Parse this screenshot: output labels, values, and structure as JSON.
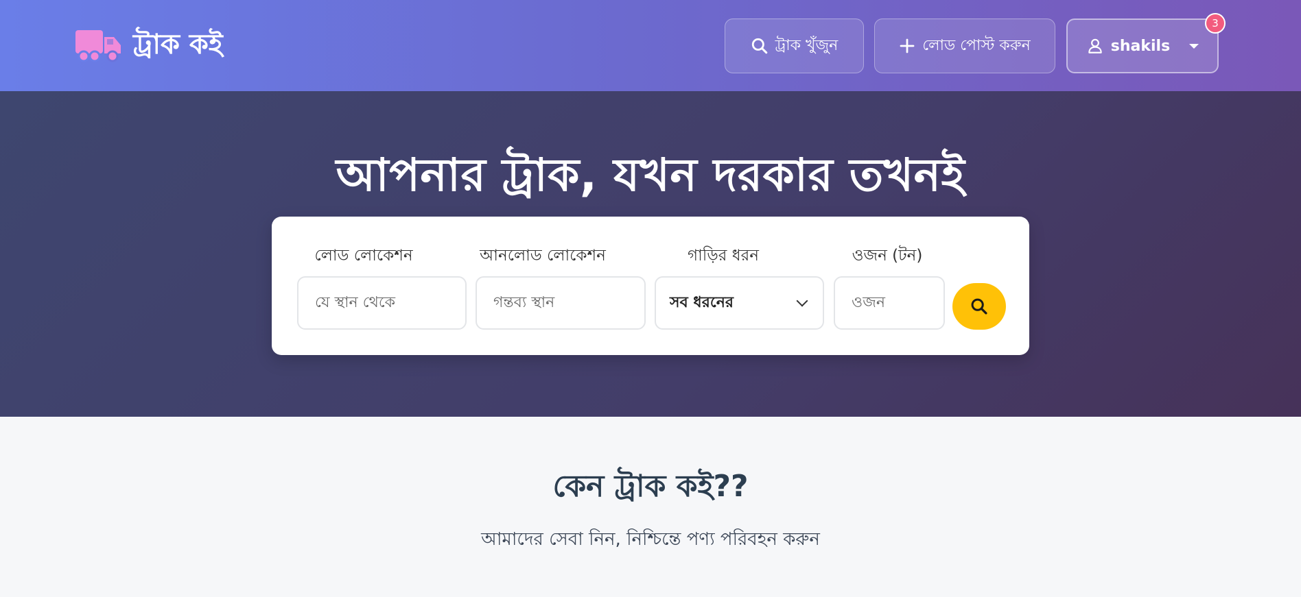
{
  "brand": {
    "name": "ট্রাক কই",
    "icon": "truck-icon",
    "icon_color": "#f08ad9"
  },
  "nav": {
    "find_truck_label": "ট্রাক খুঁজুন",
    "post_load_label": "লোড পোস্ট করুন",
    "username": "shakils",
    "notification_count": "3"
  },
  "hero": {
    "title": "আপনার ট্রাক, যখন দরকার তখনই",
    "search": {
      "load_label": "লোড লোকেশন",
      "load_placeholder": "যে স্থান থেকে",
      "unload_label": "আনলোড লোকেশন",
      "unload_placeholder": "গন্তব্য স্থান",
      "vehicle_label": "গাড়ির ধরন",
      "vehicle_selected": "সব ধরনের",
      "weight_label": "ওজন (টন)",
      "weight_placeholder": "ওজন"
    }
  },
  "why": {
    "title": "কেন ট্রাক কই??",
    "subtitle": "আমাদের সেবা নিন, নিশ্চিন্তে পণ্য পরিবহন করুন"
  },
  "colors": {
    "accent": "#ffc107",
    "badge": "#f25b7e"
  }
}
